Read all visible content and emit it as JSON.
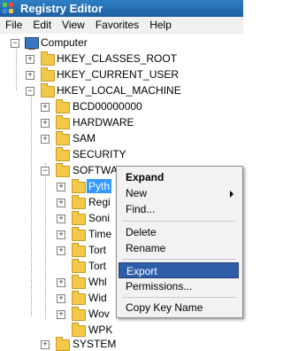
{
  "window": {
    "title": "Registry Editor"
  },
  "menu": [
    "File",
    "Edit",
    "View",
    "Favorites",
    "Help"
  ],
  "tree": {
    "computer": "Computer",
    "classes_root": "HKEY_CLASSES_ROOT",
    "current_user": "HKEY_CURRENT_USER",
    "local_machine": "HKEY_LOCAL_MACHINE",
    "bcd": "BCD00000000",
    "hardware": "HARDWARE",
    "sam": "SAM",
    "security": "SECURITY",
    "software": "SOFTWARE",
    "software_children": [
      "Pyth",
      "Regi",
      "Soni",
      "Time",
      "Tort",
      "Tort",
      "Whl",
      "Wid",
      "Wov",
      "WPK"
    ],
    "system": "SYSTEM"
  },
  "context_menu": {
    "expand": "Expand",
    "new": "New",
    "find": "Find...",
    "delete": "Delete",
    "rename": "Rename",
    "export": "Export",
    "permissions": "Permissions...",
    "copy_key_name": "Copy Key Name"
  },
  "colors": {
    "selection": "#3399ff",
    "menu_highlight": "#2f5ea8",
    "folder": "#f3c94a"
  }
}
